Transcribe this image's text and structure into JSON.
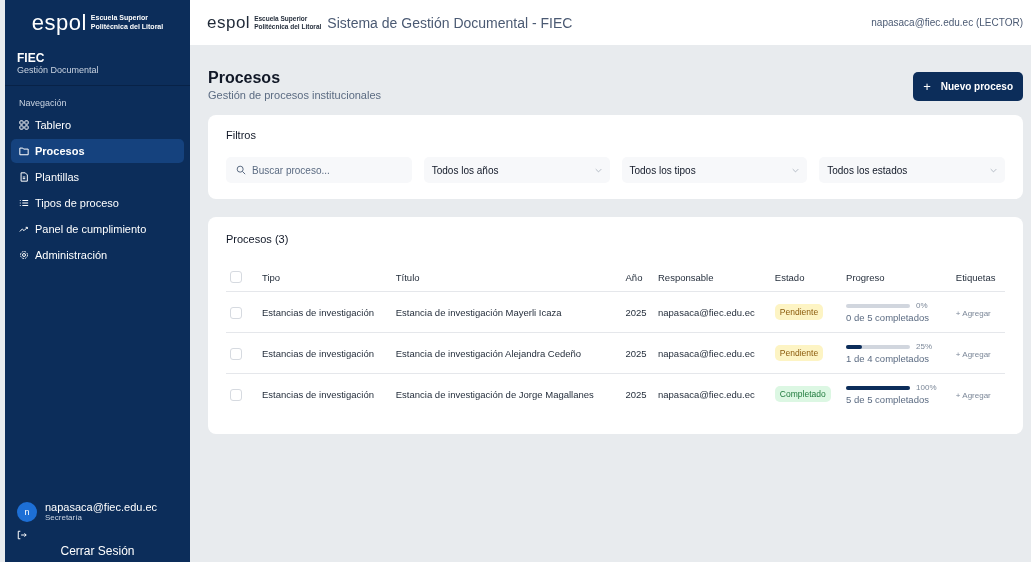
{
  "sidebar": {
    "logo": {
      "wordmark": "espol",
      "tagline_1": "Escuela Superior",
      "tagline_2": "Politécnica del Litoral"
    },
    "org": "FIEC",
    "app": "Gestión Documental",
    "section": "Navegación",
    "items": [
      {
        "label": "Tablero",
        "selected": false
      },
      {
        "label": "Procesos",
        "selected": true
      },
      {
        "label": "Plantillas",
        "selected": false
      },
      {
        "label": "Tipos de proceso",
        "selected": false
      },
      {
        "label": "Panel de cumplimiento",
        "selected": false
      },
      {
        "label": "Administración",
        "selected": false
      }
    ],
    "user": {
      "initial": "n",
      "email": "napasaca@fiec.edu.ec",
      "role": "Secretaría"
    },
    "logout": "Cerrar Sesión"
  },
  "header": {
    "logo": {
      "wordmark": "espol",
      "tagline_1": "Escuela Superior",
      "tagline_2": "Politécnica del Litoral"
    },
    "title": "Sistema de Gestión Documental - FIEC",
    "user": "napasaca@fiec.edu.ec (LECTOR)"
  },
  "page": {
    "title": "Procesos",
    "subtitle": "Gestión de procesos institucionales",
    "new_button": {
      "icon": "+",
      "label": "Nuevo proceso"
    }
  },
  "filters": {
    "title": "Filtros",
    "search": {
      "placeholder": "Buscar proceso..."
    },
    "selects": [
      "Todos los años",
      "Todos los tipos",
      "Todos los estados"
    ]
  },
  "table": {
    "title": "Procesos (3)",
    "columns": [
      "Tipo",
      "Título",
      "Año",
      "Responsable",
      "Estado",
      "Progreso",
      "Etiquetas"
    ],
    "header_checked": false,
    "rows": [
      {
        "checked": false,
        "tipo": "Estancias de investigación",
        "titulo": "Estancia de investigación Mayerli Icaza",
        "anio": "2025",
        "responsable": "napasaca@fiec.edu.ec",
        "estado": {
          "kind": "pending",
          "label": "Pendiente"
        },
        "progress": {
          "percent": "0%",
          "caption": "0 de 5 completados"
        },
        "tag_action": "+ Agregar"
      },
      {
        "checked": false,
        "tipo": "Estancias de investigación",
        "titulo": "Estancia de investigación Alejandra Cedeño",
        "anio": "2025",
        "responsable": "napasaca@fiec.edu.ec",
        "estado": {
          "kind": "pending",
          "label": "Pendiente"
        },
        "progress": {
          "level": 0.25,
          "percent": "25%",
          "caption": "1 de 4 completados"
        },
        "tag_action": "+ Agregar"
      },
      {
        "checked": false,
        "tipo": "Estancias de investigación",
        "titulo": "Estancia de investigación de Jorge Magallanes",
        "anio": "2025",
        "responsable": "napasaca@fiec.edu.ec",
        "estado": {
          "kind": "done",
          "label": "Completado"
        },
        "progress": {
          "level": 1,
          "percent": "100%",
          "caption": "5 de 5 completados"
        },
        "tag_action": "+ Agregar"
      }
    ]
  }
}
